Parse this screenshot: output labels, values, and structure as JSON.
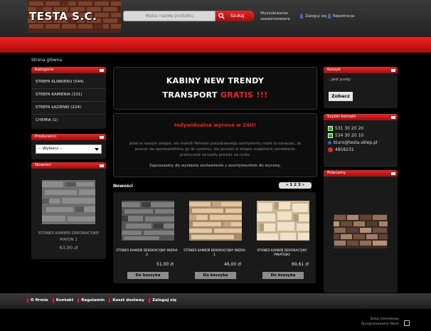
{
  "header": {
    "logo_text": "TESTA S.C.",
    "search_placeholder": "Wpisz nazwę produktu",
    "search_button": "Szukaj",
    "advanced_search": "Wyszukiwanie zaawansowane",
    "login": "Zaloguj się",
    "register": "Rejestracja"
  },
  "breadcrumb": "Strona główna",
  "categories": {
    "title": "Kategorie",
    "items": [
      "STREFA KLINKIERU (544)",
      "STREFA KAMIENIA (101)",
      "STREFA ŁAZIENKI (224)",
      "CHEMIA (1)"
    ]
  },
  "producers": {
    "title": "Producenci",
    "selected": "-- Wybierz --"
  },
  "new_side": {
    "title": "Nowości",
    "product_name": "STONES KAMIEŃ DEKORACYJNY MAYON 1",
    "price": "63,90 zł"
  },
  "promo": {
    "line1": "KABINY NEW TRENDY",
    "line2_prefix": "TRANSPORT",
    "line2_red": "GRATIS !!!"
  },
  "individual": {
    "title": "Indywidualna wycena w 24H!",
    "text": "Jeżeli w naszym sklepie, nie znaleźli Państwo poszukiwanego asortymentu może to oznaczać, że jeszcze nie wprowadziliśmy go do systemu, dla jasności w sklepie znajdziecie zamówienie praktycznie na każdy produkt na rynku.",
    "footer": "Zapraszamy do wysłania zestawienie z asortymentem do wyceny."
  },
  "news": {
    "title": "Nowości",
    "pager": "« 1 2 3 »",
    "products": [
      {
        "name": "STONES KAMIEŃ DEKORACYJNY INERIA 2",
        "price": "51,00 zł",
        "button": "Do koszyka",
        "color_a": "#5a5a5a",
        "color_b": "#8a8a8a"
      },
      {
        "name": "STONES KAMIEŃ DEKORACYJNY INERIA 1",
        "price": "46,00 zł",
        "button": "Do koszyka",
        "color_a": "#b89a78",
        "color_b": "#e2cdb0"
      },
      {
        "name": "STONES KAMIEŃ DEKORACYJNY PINATUBO",
        "price": "69,61 zł",
        "button": "Do koszyka",
        "color_a": "#c9b89a",
        "color_b": "#efe3cc"
      }
    ]
  },
  "cart": {
    "title": "Koszyk",
    "empty": "...jest pusty",
    "button": "Zobacz"
  },
  "contact": {
    "title": "Szybki kontakt",
    "phone1": "531 30 20 20",
    "phone2": "534 30 20 10",
    "email": "biuro@testa.sklep.pl",
    "gg": "4856231"
  },
  "recommended": {
    "title": "Polecamy"
  },
  "footer": {
    "links": [
      "O firmie",
      "Kontakt",
      "Regulamin",
      "Koszt dostawy",
      "Zaloguj się"
    ],
    "credit1": "Sklep internetowy",
    "credit2": "Oprogramowanie iStore"
  },
  "colors": {
    "accent_red": "#e22222",
    "dark": "#1a1a1a"
  }
}
